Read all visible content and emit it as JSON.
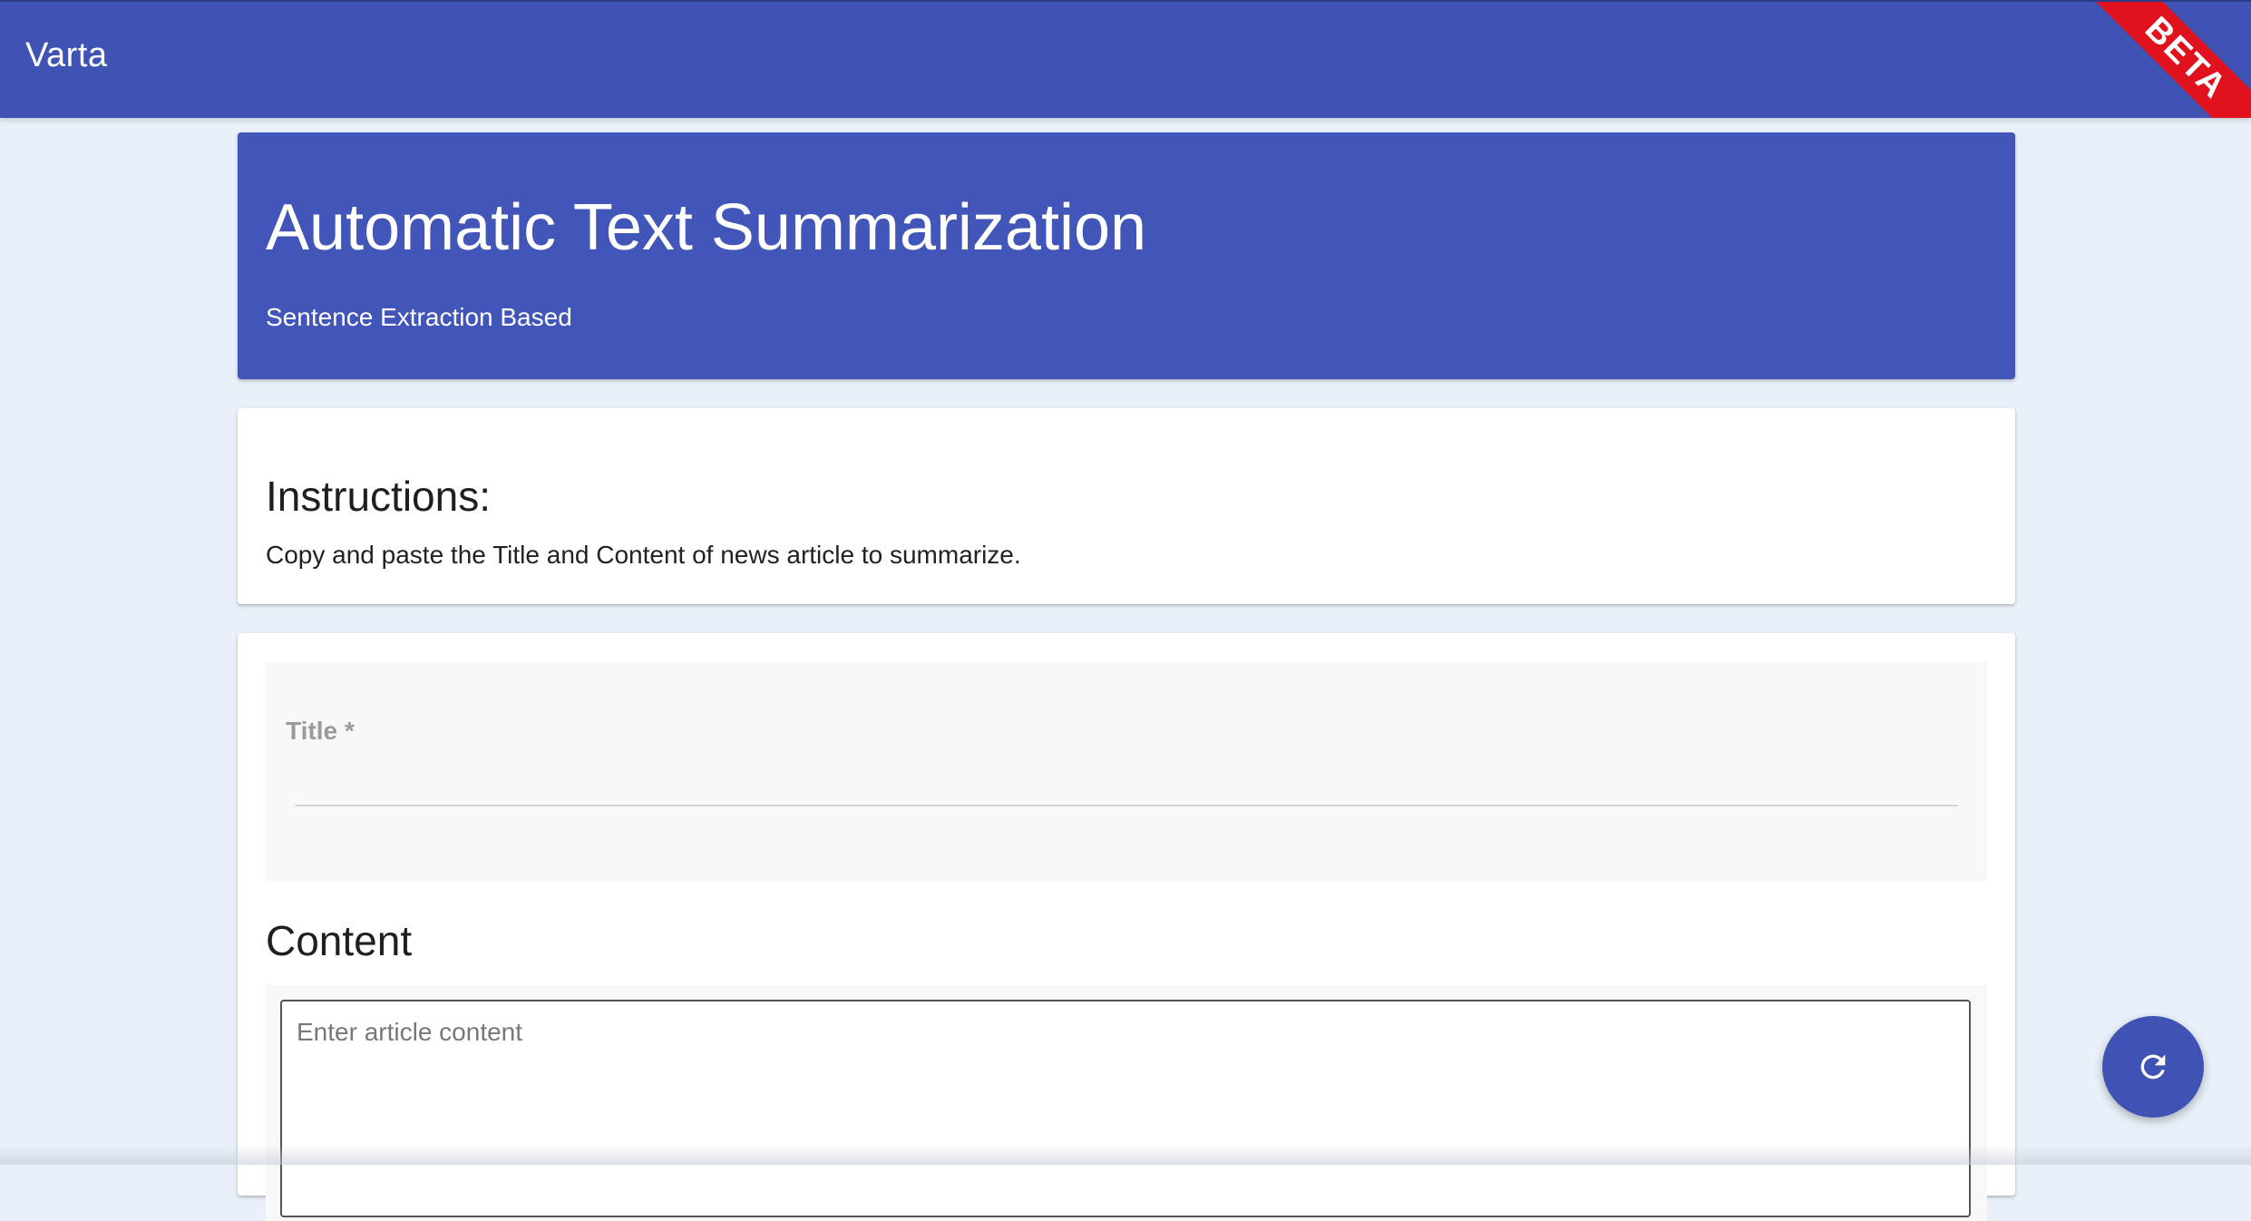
{
  "app": {
    "brand": "Varta",
    "badge": "BETA"
  },
  "hero": {
    "title": "Automatic Text Summarization",
    "subtitle": "Sentence Extraction Based"
  },
  "instructions": {
    "heading": "Instructions:",
    "body": "Copy and paste the Title and Content of news article to summarize."
  },
  "form": {
    "title_label": "Title *",
    "title_value": "",
    "content_heading": "Content",
    "content_placeholder": "Enter article content",
    "content_value": ""
  },
  "fab": {
    "icon": "refresh-icon"
  },
  "colors": {
    "primary": "#3f53b4",
    "badge": "#e0121d",
    "background": "#e9f0f9"
  }
}
